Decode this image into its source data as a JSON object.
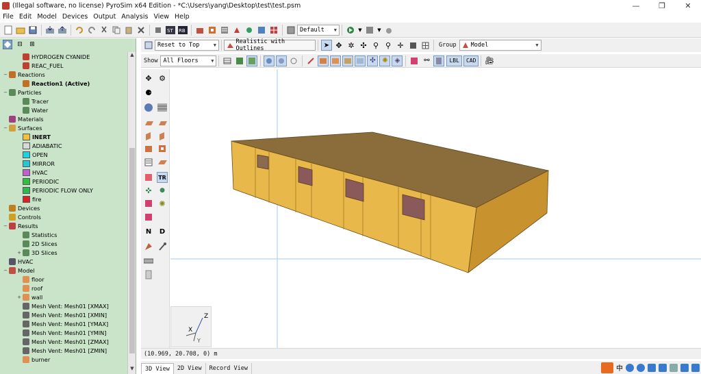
{
  "window": {
    "title": "(Illegal software, no license) PyroSim x64 Edition - *C:\\Users\\yang\\Desktop\\test\\test.psm",
    "controls": [
      "—",
      "❐",
      "✕"
    ]
  },
  "menu": [
    "File",
    "Edit",
    "Model",
    "Devices",
    "Output",
    "Analysis",
    "View",
    "Help"
  ],
  "toolbar": {
    "group_preset": "Default"
  },
  "view_toolbar": {
    "reset_label": "Reset to Top",
    "render_mode": "Realistic with Outlines",
    "group_label": "Group",
    "group_value": "Model",
    "show_label": "Show",
    "floors_value": "All Floors",
    "lbl_label": "LBL",
    "cad_label": "CAD"
  },
  "tree": {
    "items": [
      {
        "label": "HYDROGEN CYANIDE",
        "indent": 2,
        "icon": "species-icon"
      },
      {
        "label": "REAC_FUEL",
        "indent": 2,
        "icon": "species-icon"
      },
      {
        "label": "Reactions",
        "indent": 0,
        "icon": "reaction-icon",
        "expander": "−"
      },
      {
        "label": "Reaction1 (Active)",
        "indent": 2,
        "icon": "reaction-icon",
        "bold": true
      },
      {
        "label": "Particles",
        "indent": 0,
        "icon": "particles-icon",
        "expander": "−"
      },
      {
        "label": "Tracer",
        "indent": 2,
        "icon": "particle-icon"
      },
      {
        "label": "Water",
        "indent": 2,
        "icon": "particle-icon"
      },
      {
        "label": "Materials",
        "indent": 0,
        "icon": "materials-icon"
      },
      {
        "label": "Surfaces",
        "indent": 0,
        "icon": "surfaces-icon",
        "expander": "−"
      },
      {
        "label": "INERT",
        "indent": 2,
        "swatch": "#f0c040",
        "bold": true
      },
      {
        "label": "ADIABATIC",
        "indent": 2,
        "swatch": "#d8d8d8"
      },
      {
        "label": "OPEN",
        "indent": 2,
        "swatch": "#20d0e0"
      },
      {
        "label": "MIRROR",
        "indent": 2,
        "swatch": "#20c8d8"
      },
      {
        "label": "HVAC",
        "indent": 2,
        "swatch": "#c060d0"
      },
      {
        "label": "PERIODIC",
        "indent": 2,
        "swatch": "#30c040"
      },
      {
        "label": "PERIODIC FLOW ONLY",
        "indent": 2,
        "swatch": "#30b850"
      },
      {
        "label": "fire",
        "indent": 2,
        "swatch": "#e02020"
      },
      {
        "label": "Devices",
        "indent": 0,
        "icon": "devices-icon"
      },
      {
        "label": "Controls",
        "indent": 0,
        "icon": "controls-icon"
      },
      {
        "label": "Results",
        "indent": 0,
        "icon": "results-icon",
        "expander": "−"
      },
      {
        "label": "Statistics",
        "indent": 2,
        "icon": "statistics-icon"
      },
      {
        "label": "2D Slices",
        "indent": 2,
        "icon": "slices-icon"
      },
      {
        "label": "3D Slices",
        "indent": 2,
        "icon": "slices-icon",
        "expander": "+"
      },
      {
        "label": "HVAC",
        "indent": 0,
        "icon": "hvac-icon"
      },
      {
        "label": "Model",
        "indent": 0,
        "icon": "model-icon",
        "expander": "−"
      },
      {
        "label": "floor",
        "indent": 2,
        "icon": "obstruction-icon"
      },
      {
        "label": "roof",
        "indent": 2,
        "icon": "obstruction-icon"
      },
      {
        "label": "wall",
        "indent": 2,
        "icon": "obstruction-icon",
        "expander": "+"
      },
      {
        "label": "Mesh Vent: Mesh01 [XMAX]",
        "indent": 2,
        "icon": "vent-icon"
      },
      {
        "label": "Mesh Vent: Mesh01 [XMIN]",
        "indent": 2,
        "icon": "vent-icon"
      },
      {
        "label": "Mesh Vent: Mesh01 [YMAX]",
        "indent": 2,
        "icon": "vent-icon"
      },
      {
        "label": "Mesh Vent: Mesh01 [YMIN]",
        "indent": 2,
        "icon": "vent-icon"
      },
      {
        "label": "Mesh Vent: Mesh01 [ZMAX]",
        "indent": 2,
        "icon": "vent-icon"
      },
      {
        "label": "Mesh Vent: Mesh01 [ZMIN]",
        "indent": 2,
        "icon": "vent-icon"
      },
      {
        "label": "burner",
        "indent": 2,
        "icon": "obstruction-icon"
      }
    ]
  },
  "toolbox": {
    "n_label": "N",
    "d_label": "D",
    "tr_label": "TR"
  },
  "axes": {
    "z_label": "Z",
    "x_label": "X",
    "y_label": "Y"
  },
  "status": {
    "coords": "(10.969, 20.708, 0) m"
  },
  "view_tabs": [
    {
      "label": "3D View",
      "active": true
    },
    {
      "label": "2D View",
      "active": false
    },
    {
      "label": "Record View",
      "active": false
    }
  ],
  "tray": {
    "ime_label": "中"
  },
  "colors": {
    "tree_bg": "#c9e4c9",
    "wall_front": "#e8b84a",
    "wall_side": "#d9a436",
    "roof": "#8a6d3a",
    "guide_line": "#a8c8e8"
  }
}
